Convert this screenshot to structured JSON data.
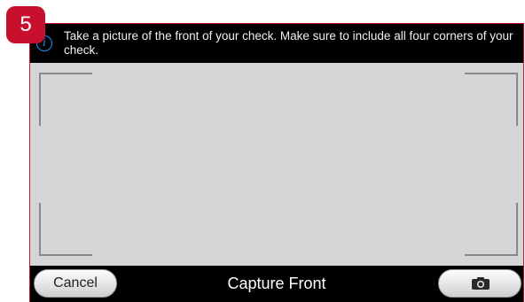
{
  "step_badge": "5",
  "info": {
    "icon": "info-icon",
    "icon_glyph": "i",
    "message": "Take a picture of the front of your check. Make sure to include all four corners of your check."
  },
  "bottom_bar": {
    "cancel_label": "Cancel",
    "title": "Capture Front",
    "camera_icon": "camera-icon"
  },
  "colors": {
    "badge": "#c8102e",
    "info_icon": "#1e90ff",
    "viewfinder": "#d6d6d6",
    "bar_background": "#000000"
  }
}
